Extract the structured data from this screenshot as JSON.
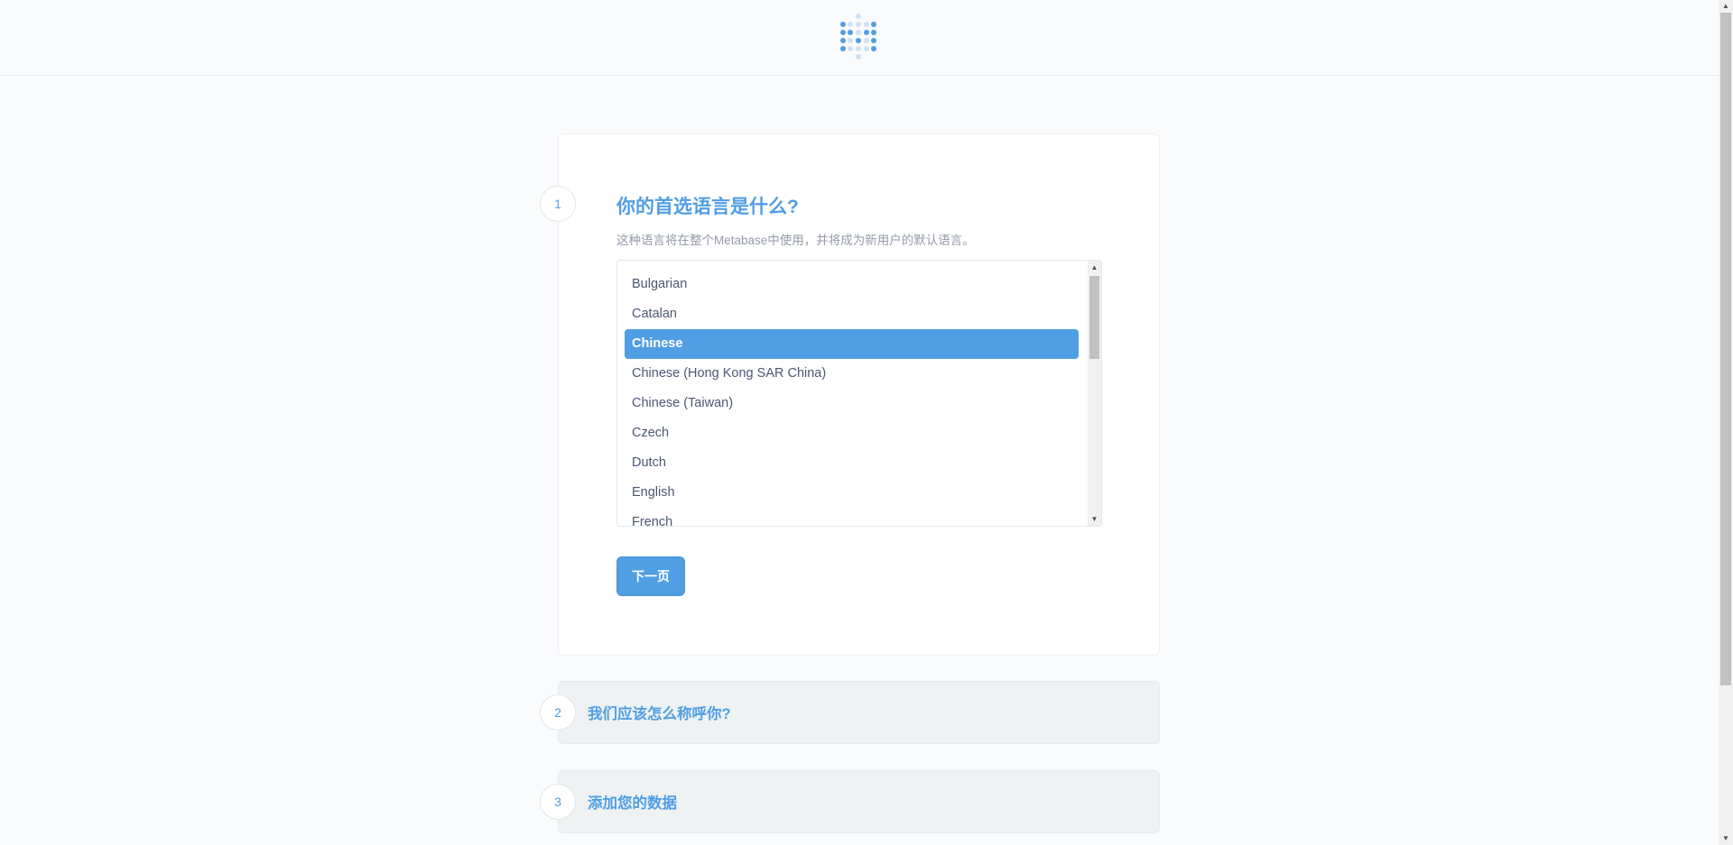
{
  "step1": {
    "number": "1",
    "title": "你的首选语言是什么?",
    "description": "这种语言将在整个Metabase中使用，并将成为新用户的默认语言。",
    "languages": [
      "Bulgarian",
      "Catalan",
      "Chinese",
      "Chinese (Hong Kong SAR China)",
      "Chinese (Taiwan)",
      "Czech",
      "Dutch",
      "English",
      "French"
    ],
    "selected_language": "Chinese",
    "next_label": "下一页"
  },
  "step2": {
    "number": "2",
    "title": "我们应该怎么称呼你?"
  },
  "step3": {
    "number": "3",
    "title": "添加您的数据"
  },
  "colors": {
    "accent": "#509ee3",
    "background": "#f9fbfc",
    "inactive_card": "#eef2f3"
  }
}
